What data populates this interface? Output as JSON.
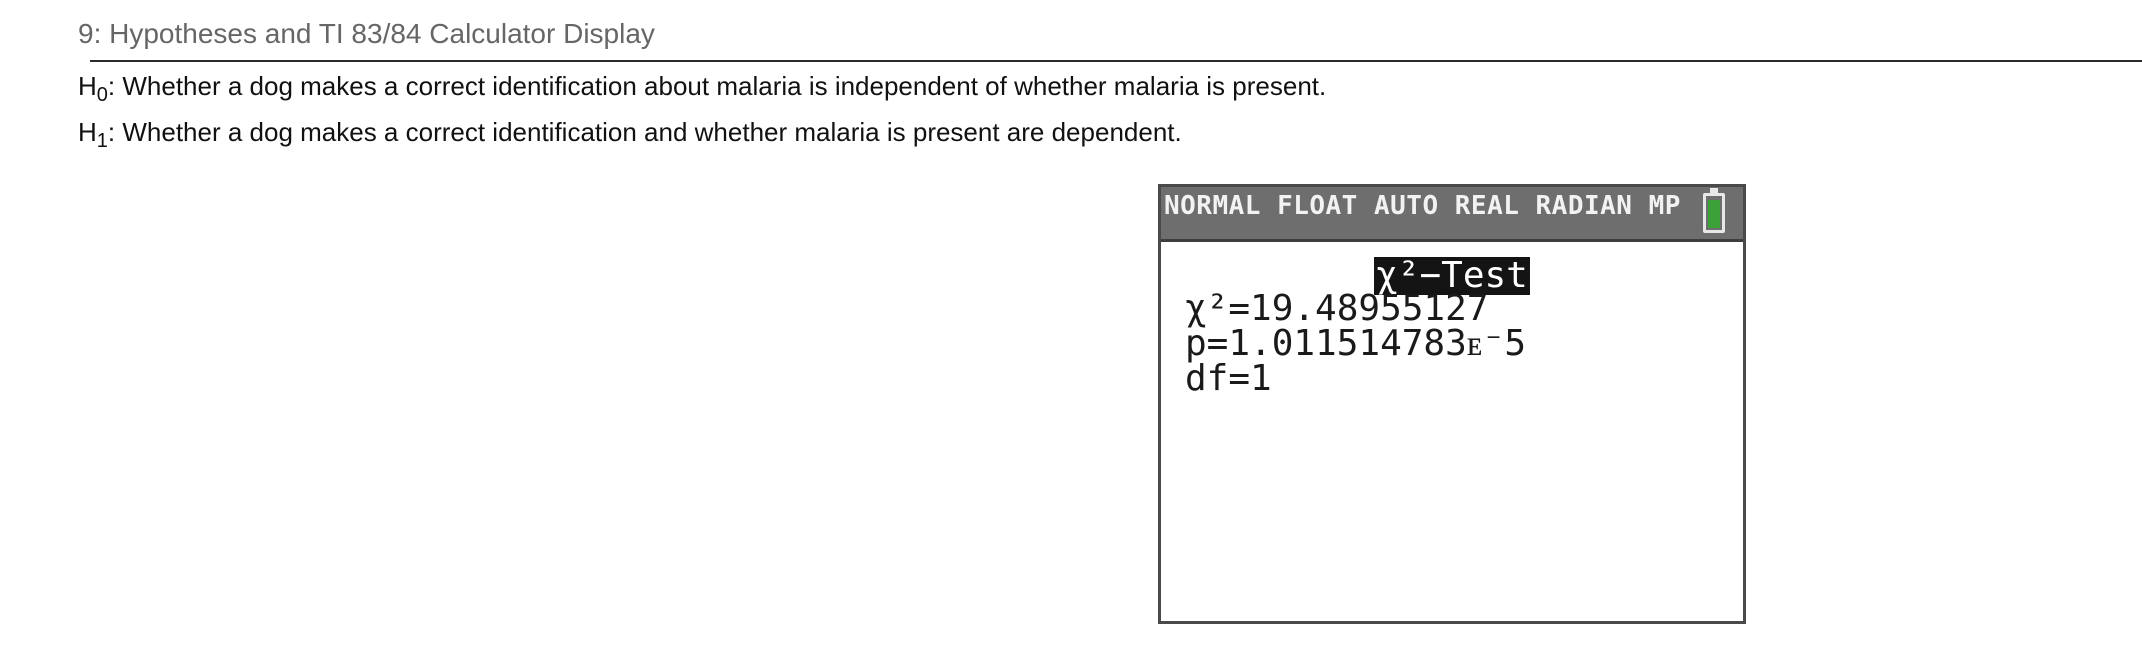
{
  "section": {
    "title": "9: Hypotheses and TI 83/84 Calculator Display"
  },
  "hypotheses": {
    "h0": {
      "symbol": "H",
      "subscript": "0",
      "text": ": Whether a dog makes a correct identification about malaria is independent of whether malaria is present."
    },
    "h1": {
      "symbol": "H",
      "subscript": "1",
      "text": ": Whether a dog makes a correct identification and whether malaria is present are dependent."
    }
  },
  "calculator": {
    "status_bar": "NORMAL FLOAT AUTO REAL RADIAN MP",
    "battery_color": "#3da13a",
    "heading": "χ²−Test",
    "lines": [
      "χ²=19.48955127",
      "p=1.011514783ᴇ⁻5",
      "df=1"
    ]
  }
}
